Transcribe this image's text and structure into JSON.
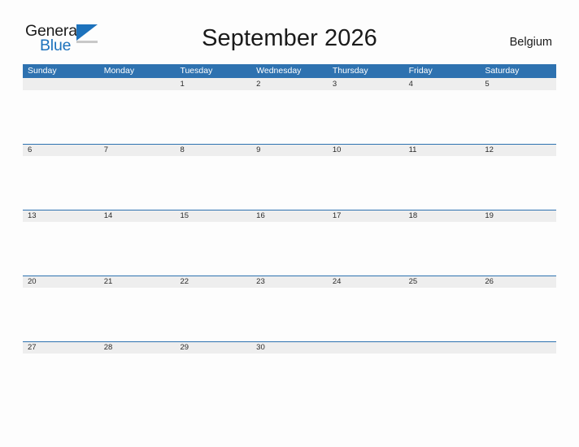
{
  "brand": {
    "name_part1": "General",
    "name_part2": "Blue",
    "triangle_color": "#1d72bc"
  },
  "header": {
    "title": "September 2026",
    "country": "Belgium"
  },
  "colors": {
    "header_blue": "#2e72b0",
    "row_band_gray": "#eeeeee",
    "page_background": "#fdfdfd",
    "brand_blue": "#1d72bc"
  },
  "calendar": {
    "month": "September",
    "year": "2026",
    "weekday_headers": [
      "Sunday",
      "Monday",
      "Tuesday",
      "Wednesday",
      "Thursday",
      "Friday",
      "Saturday"
    ],
    "weeks": [
      {
        "days": [
          "",
          "",
          "1",
          "2",
          "3",
          "4",
          "5"
        ]
      },
      {
        "days": [
          "6",
          "7",
          "8",
          "9",
          "10",
          "11",
          "12"
        ]
      },
      {
        "days": [
          "13",
          "14",
          "15",
          "16",
          "17",
          "18",
          "19"
        ]
      },
      {
        "days": [
          "20",
          "21",
          "22",
          "23",
          "24",
          "25",
          "26"
        ]
      },
      {
        "days": [
          "27",
          "28",
          "29",
          "30",
          "",
          "",
          ""
        ]
      }
    ]
  }
}
